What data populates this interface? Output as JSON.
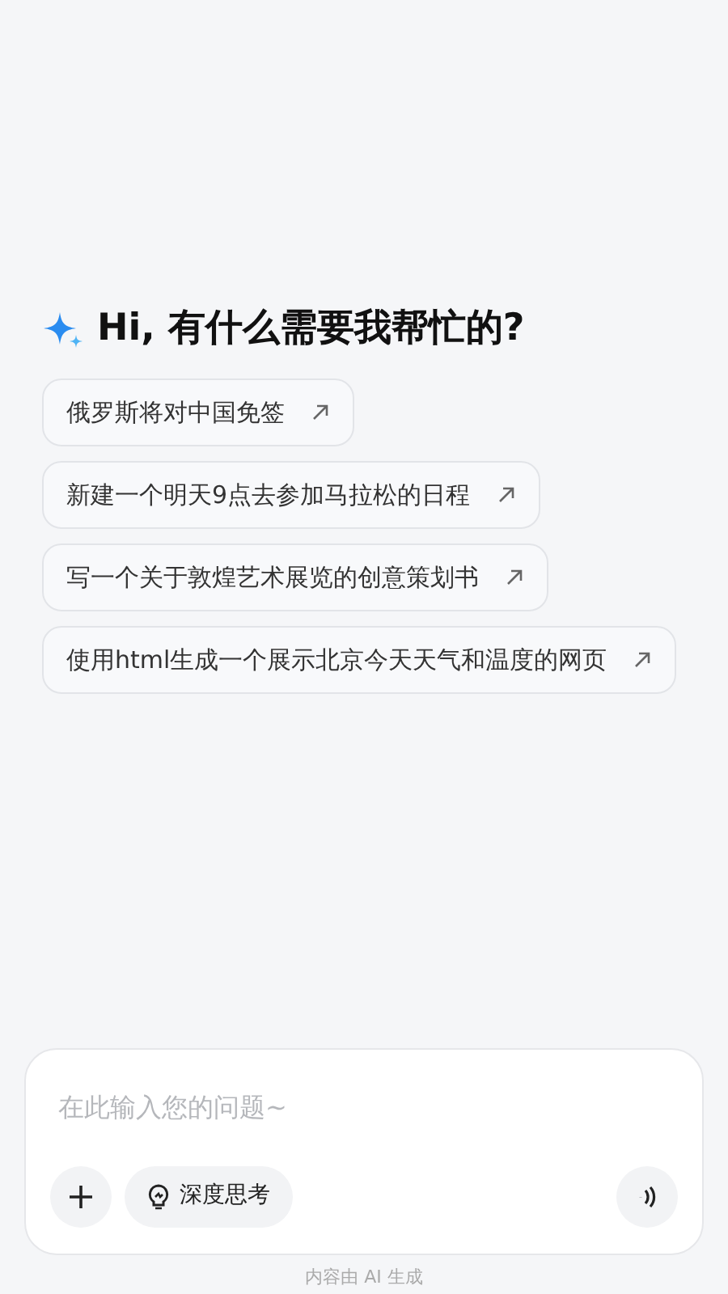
{
  "greeting": "Hi, 有什么需要我帮忙的?",
  "suggestions": [
    {
      "text": "俄罗斯将对中国免签"
    },
    {
      "text": "新建一个明天9点去参加马拉松的日程"
    },
    {
      "text": "写一个关于敦煌艺术展览的创意策划书"
    },
    {
      "text": "使用html生成一个展示北京今天天气和温度的网页"
    }
  ],
  "composer": {
    "placeholder": "在此输入您的问题~",
    "deep_think": {
      "label": "深度思考",
      "on": false
    }
  },
  "footer": "内容由 AI 生成"
}
